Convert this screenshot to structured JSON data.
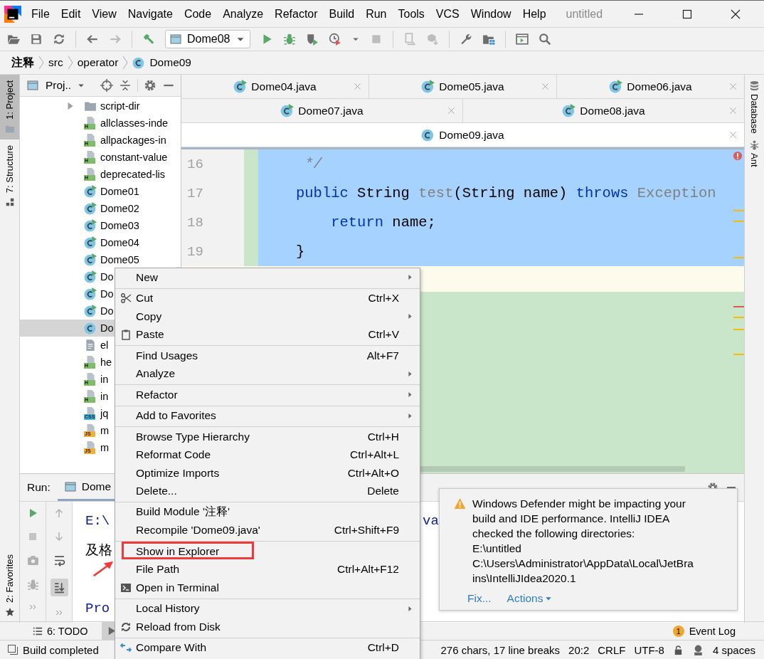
{
  "window": {
    "title": "untitled"
  },
  "menu_bar": [
    "File",
    "Edit",
    "View",
    "Navigate",
    "Code",
    "Analyze",
    "Refactor",
    "Build",
    "Run",
    "Tools",
    "VCS",
    "Window",
    "Help"
  ],
  "toolbar": {
    "run_config": "Dome08",
    "groups": [
      [
        {
          "kind": "open",
          "disabled": false
        },
        {
          "kind": "save",
          "disabled": false
        },
        {
          "kind": "sync",
          "disabled": false
        }
      ],
      [
        {
          "kind": "back",
          "disabled": false
        },
        {
          "kind": "forward",
          "disabled": true
        }
      ],
      [
        {
          "kind": "hammer",
          "disabled": false
        },
        {
          "kind": "config",
          "disabled": false
        },
        {
          "kind": "run",
          "disabled": false
        },
        {
          "kind": "debug",
          "disabled": false
        },
        {
          "kind": "coverage",
          "disabled": false
        },
        {
          "kind": "profile",
          "disabled": false
        },
        {
          "kind": "stop",
          "disabled": true
        }
      ],
      [
        {
          "kind": "device",
          "disabled": true
        },
        {
          "kind": "sdk",
          "disabled": true
        }
      ],
      [
        {
          "kind": "wrench",
          "disabled": false
        },
        {
          "kind": "structure",
          "disabled": false
        }
      ],
      [
        {
          "kind": "runanything",
          "disabled": false
        },
        {
          "kind": "search",
          "disabled": false
        }
      ]
    ]
  },
  "breadcrumb": [
    {
      "label": "注释",
      "kind": "module"
    },
    {
      "label": "src",
      "kind": "folder"
    },
    {
      "label": "operator",
      "kind": "folder"
    },
    {
      "label": "Dome09",
      "kind": "class"
    }
  ],
  "left_stripe": [
    {
      "label": "1: Project",
      "kind": "project",
      "selected": true
    },
    {
      "label": "7: Structure",
      "kind": "structure",
      "selected": false
    }
  ],
  "left_stripe_bottom": [
    {
      "label": "2: Favorites",
      "kind": "favorites",
      "selected": false
    }
  ],
  "right_stripe": [
    {
      "label": "Database",
      "kind": "database"
    },
    {
      "label": "Ant",
      "kind": "ant"
    }
  ],
  "project_panel": {
    "title": "Proj..",
    "tree": [
      {
        "label": "script-dir",
        "kind": "folder",
        "expanded": false,
        "selected": false
      },
      {
        "label": "allclasses-inde",
        "kind": "html",
        "badge": "H",
        "selected": false
      },
      {
        "label": "allpackages-in",
        "kind": "html",
        "badge": "H",
        "selected": false
      },
      {
        "label": "constant-value",
        "kind": "html",
        "badge": "H",
        "selected": false
      },
      {
        "label": "deprecated-lis",
        "kind": "html",
        "badge": "H",
        "selected": false
      },
      {
        "label": "Dome01",
        "kind": "class",
        "runnable": true,
        "selected": false
      },
      {
        "label": "Dome02",
        "kind": "class",
        "runnable": true,
        "selected": false
      },
      {
        "label": "Dome03",
        "kind": "class",
        "runnable": true,
        "selected": false
      },
      {
        "label": "Dome04",
        "kind": "class",
        "runnable": true,
        "selected": false
      },
      {
        "label": "Dome05",
        "kind": "class",
        "runnable": true,
        "selected": false
      },
      {
        "label": "Do",
        "kind": "class",
        "runnable": true,
        "selected": false
      },
      {
        "label": "Do",
        "kind": "class",
        "runnable": true,
        "selected": false
      },
      {
        "label": "Do",
        "kind": "class",
        "runnable": true,
        "selected": false
      },
      {
        "label": "Do",
        "kind": "class",
        "runnable": false,
        "selected": true
      },
      {
        "label": "el",
        "kind": "text",
        "selected": false
      },
      {
        "label": "he",
        "kind": "html",
        "badge": "H",
        "selected": false
      },
      {
        "label": "in",
        "kind": "html",
        "badge": "H",
        "selected": false
      },
      {
        "label": "in",
        "kind": "html",
        "badge": "H",
        "selected": false
      },
      {
        "label": "jq",
        "kind": "css",
        "badge": "CSS",
        "selected": false
      },
      {
        "label": "m",
        "kind": "js",
        "badge": "JS",
        "selected": false
      },
      {
        "label": "m",
        "kind": "js",
        "badge": "JS",
        "selected": false
      }
    ]
  },
  "editor": {
    "tab_rows": [
      [
        {
          "label": "Dome04.java",
          "runnable": true,
          "selected": false
        },
        {
          "label": "Dome05.java",
          "runnable": true,
          "selected": false
        },
        {
          "label": "Dome06.java",
          "runnable": true,
          "selected": false
        }
      ],
      [
        {
          "label": "Dome07.java",
          "runnable": true,
          "selected": false
        },
        {
          "label": "Dome08.java",
          "runnable": true,
          "selected": false
        }
      ],
      [
        {
          "label": "Dome09.java",
          "runnable": false,
          "selected": true
        }
      ]
    ],
    "lines": [
      {
        "number": "16",
        "selected": true,
        "tokens": [
          {
            "text": " */",
            "kind": "comment"
          }
        ]
      },
      {
        "number": "17",
        "selected": true,
        "tokens": [
          {
            "text": "public",
            "kind": "keyword"
          },
          {
            "text": " String ",
            "kind": "plain"
          },
          {
            "text": "test",
            "kind": "unused"
          },
          {
            "text": "(String name) ",
            "kind": "plain"
          },
          {
            "text": "throws",
            "kind": "keyword"
          },
          {
            "text": " Exception",
            "kind": "unused"
          }
        ]
      },
      {
        "number": "18",
        "selected": true,
        "tokens": [
          {
            "text": "    return",
            "kind": "keyword"
          },
          {
            "text": " name;",
            "kind": "plain"
          }
        ]
      },
      {
        "number": "19",
        "selected": true,
        "tokens": [
          {
            "text": "}",
            "kind": "plain"
          }
        ]
      }
    ],
    "has_error": true
  },
  "run_panel": {
    "label": "Run:",
    "tab": "Dome",
    "console": [
      {
        "text": "E:\\",
        "kind": "path",
        "tail": "va"
      },
      {
        "text": "及格",
        "kind": "plain"
      },
      {
        "text": "Pro",
        "kind": "exit"
      }
    ]
  },
  "context_menu": {
    "groups": [
      [
        {
          "label": "New",
          "submenu": true,
          "annotated": false
        }
      ],
      [
        {
          "label": "Cut",
          "kind": "cut",
          "shortcut": "Ctrl+X",
          "submenu": false,
          "annotated": false
        },
        {
          "label": "Copy",
          "submenu": true,
          "annotated": false
        },
        {
          "label": "Paste",
          "kind": "paste",
          "shortcut": "Ctrl+V",
          "submenu": false,
          "annotated": false
        }
      ],
      [
        {
          "label": "Find Usages",
          "shortcut": "Alt+F7",
          "submenu": false,
          "annotated": false
        },
        {
          "label": "Analyze",
          "submenu": true,
          "annotated": false
        }
      ],
      [
        {
          "label": "Refactor",
          "submenu": true,
          "annotated": false
        }
      ],
      [
        {
          "label": "Add to Favorites",
          "submenu": true,
          "annotated": false
        }
      ],
      [
        {
          "label": "Browse Type Hierarchy",
          "shortcut": "Ctrl+H",
          "submenu": false,
          "annotated": false
        },
        {
          "label": "Reformat Code",
          "shortcut": "Ctrl+Alt+L",
          "submenu": false,
          "annotated": false
        },
        {
          "label": "Optimize Imports",
          "shortcut": "Ctrl+Alt+O",
          "submenu": false,
          "annotated": false
        },
        {
          "label": "Delete...",
          "shortcut": "Delete",
          "submenu": false,
          "annotated": false
        }
      ],
      [
        {
          "label": "Build Module '注释'",
          "submenu": false,
          "annotated": false
        },
        {
          "label": "Recompile 'Dome09.java'",
          "shortcut": "Ctrl+Shift+F9",
          "submenu": false,
          "annotated": false
        }
      ],
      [
        {
          "label": "Show in Explorer",
          "submenu": false,
          "annotated": true
        },
        {
          "label": "File Path",
          "shortcut": "Ctrl+Alt+F12",
          "submenu": false,
          "annotated": false
        },
        {
          "label": "Open in Terminal",
          "kind": "terminal",
          "submenu": false,
          "annotated": false
        }
      ],
      [
        {
          "label": "Local History",
          "submenu": true,
          "annotated": false
        },
        {
          "label": "Reload from Disk",
          "kind": "reload",
          "submenu": false,
          "annotated": false
        }
      ],
      [
        {
          "label": "Compare With",
          "kind": "compare",
          "shortcut": "Ctrl+D",
          "submenu": false,
          "annotated": false
        }
      ]
    ]
  },
  "notification": {
    "kind": "warning",
    "lines": [
      "Windows Defender might be impacting your",
      "build and IDE performance. IntelliJ IDEA",
      "checked the following directories:",
      "E:\\untitled",
      "C:\\Users\\Administrator\\AppData\\Local\\JetBra",
      "ins\\IntelliJIdea2020.1"
    ],
    "actions": [
      {
        "label": "Fix...",
        "dropdown": false
      },
      {
        "label": "Actions",
        "dropdown": true
      }
    ]
  },
  "tool_tabs": [
    {
      "label": "6: TODO",
      "kind": "todo",
      "selected": false
    },
    {
      "kind": "run",
      "selected": true
    }
  ],
  "event_log": {
    "label": "Event Log",
    "count": "1"
  },
  "status_bar": {
    "message": "Build completed",
    "items": [
      {
        "kind": "text",
        "text": "276 chars, 17 line breaks"
      },
      {
        "kind": "text",
        "text": "20:2"
      },
      {
        "kind": "text",
        "text": "CRLF"
      },
      {
        "kind": "text",
        "text": "UTF-8"
      },
      {
        "kind": "lock"
      },
      {
        "kind": "inspector"
      },
      {
        "kind": "text",
        "text": "4 spaces"
      }
    ]
  }
}
